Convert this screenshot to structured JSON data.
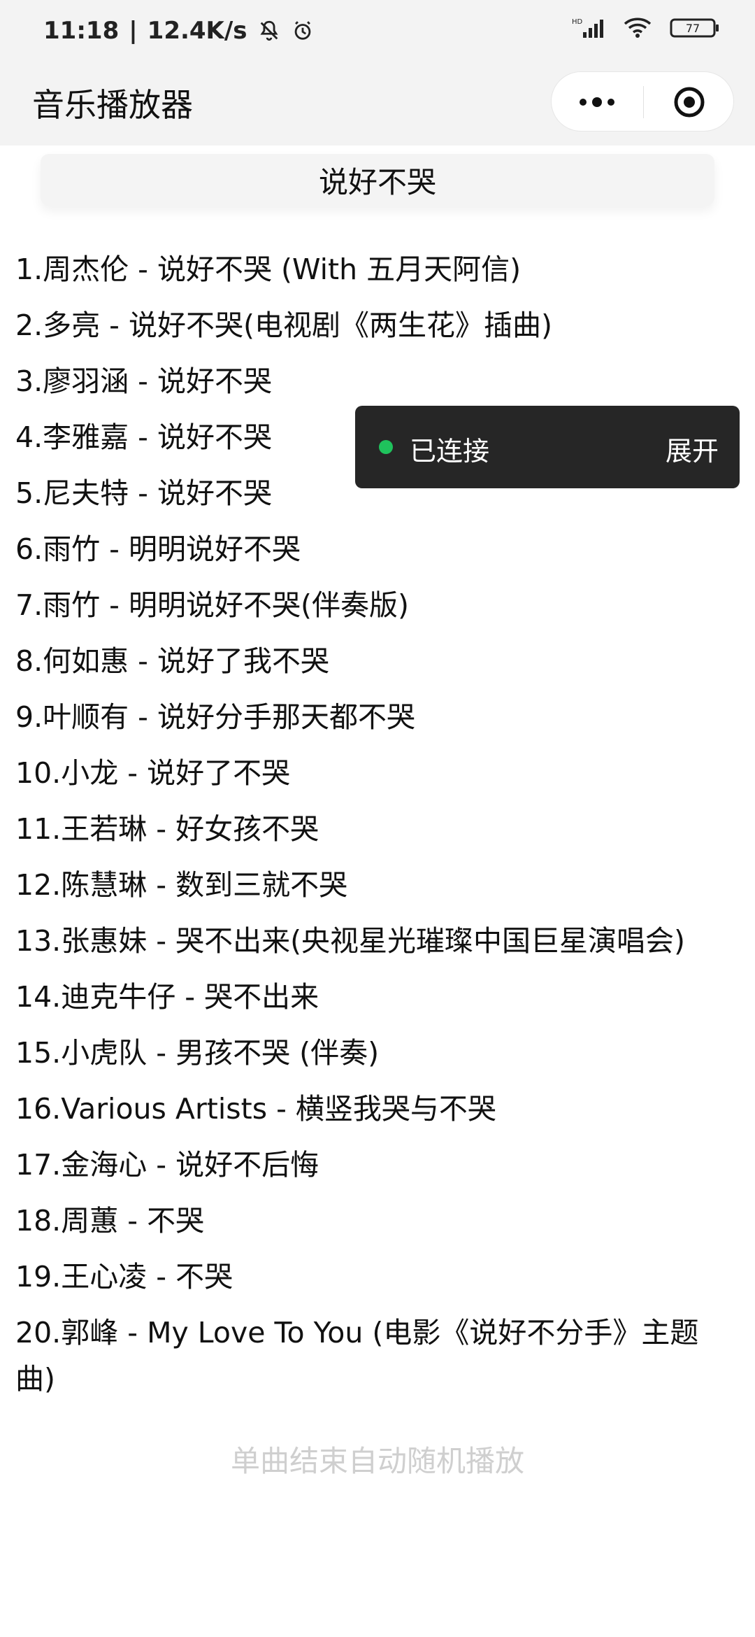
{
  "status_bar": {
    "time": "11:18",
    "net_speed": "12.4K/s",
    "battery": "77",
    "icons": [
      "bell-off-icon",
      "alarm-icon",
      "hd-signal-icon",
      "wifi-icon",
      "battery-icon"
    ]
  },
  "header": {
    "title": "音乐播放器",
    "icons": [
      "more-dots-icon",
      "target-icon"
    ]
  },
  "search": {
    "keyword": "说好不哭"
  },
  "songs": [
    "1.周杰伦 - 说好不哭 (With 五月天阿信)",
    "2.多亮 - 说好不哭(电视剧《两生花》插曲)",
    "3.廖羽涵 - 说好不哭",
    "4.李雅嘉 - 说好不哭",
    "5.尼夫特 - 说好不哭",
    "6.雨竹 - 明明说好不哭",
    "7.雨竹 - 明明说好不哭(伴奏版)",
    "8.何如惠 - 说好了我不哭",
    "9.叶顺有 - 说好分手那天都不哭",
    "10.小龙 - 说好了不哭",
    "11.王若琳 - 好女孩不哭",
    "12.陈慧琳 - 数到三就不哭",
    "13.张惠妹 - 哭不出来(央视星光璀璨中国巨星演唱会)",
    "14.迪克牛仔 - 哭不出来",
    "15.小虎队 - 男孩不哭 (伴奏)",
    "16.Various Artists - 横竖我哭与不哭",
    "17.金海心 - 说好不后悔",
    "18.周蕙 - 不哭",
    "19.王心凌 - 不哭",
    "20.郭峰 - My Love To You (电影《说好不分手》主题曲)"
  ],
  "footer": {
    "note": "单曲结束自动随机播放"
  },
  "toast": {
    "status": "已连接",
    "action": "展开",
    "status_color": "#1fc25c"
  }
}
